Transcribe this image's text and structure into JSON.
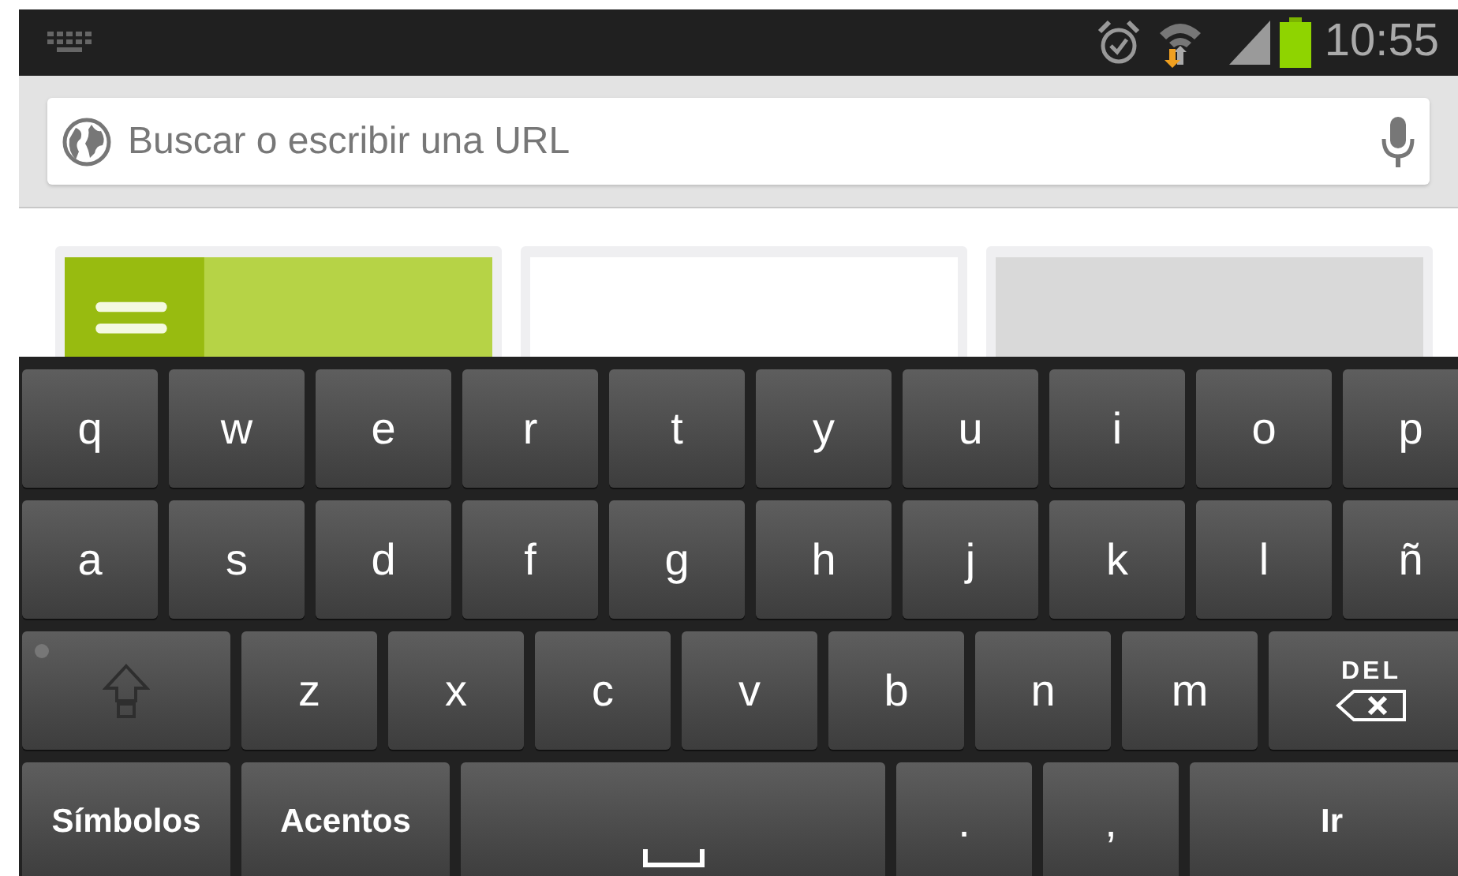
{
  "status_bar": {
    "time": "10:55"
  },
  "address_bar": {
    "placeholder": "Buscar o escribir una URL"
  },
  "thumbnails": [
    {
      "kind": "picture"
    },
    {
      "kind": "blank"
    },
    {
      "kind": "loading"
    }
  ],
  "keyboard": {
    "rows": [
      [
        {
          "kind": "char",
          "label": "q"
        },
        {
          "kind": "char",
          "label": "w"
        },
        {
          "kind": "char",
          "label": "e"
        },
        {
          "kind": "char",
          "label": "r"
        },
        {
          "kind": "char",
          "label": "t"
        },
        {
          "kind": "char",
          "label": "y"
        },
        {
          "kind": "char",
          "label": "u"
        },
        {
          "kind": "char",
          "label": "i"
        },
        {
          "kind": "char",
          "label": "o"
        },
        {
          "kind": "char",
          "label": "p"
        }
      ],
      [
        {
          "kind": "char",
          "label": "a"
        },
        {
          "kind": "char",
          "label": "s"
        },
        {
          "kind": "char",
          "label": "d"
        },
        {
          "kind": "char",
          "label": "f"
        },
        {
          "kind": "char",
          "label": "g"
        },
        {
          "kind": "char",
          "label": "h"
        },
        {
          "kind": "char",
          "label": "j"
        },
        {
          "kind": "char",
          "label": "k"
        },
        {
          "kind": "char",
          "label": "l"
        },
        {
          "kind": "char",
          "label": "ñ"
        }
      ],
      [
        {
          "kind": "shift"
        },
        {
          "kind": "char",
          "label": "z"
        },
        {
          "kind": "char",
          "label": "x"
        },
        {
          "kind": "char",
          "label": "c"
        },
        {
          "kind": "char",
          "label": "v"
        },
        {
          "kind": "char",
          "label": "b"
        },
        {
          "kind": "char",
          "label": "n"
        },
        {
          "kind": "char",
          "label": "m"
        },
        {
          "kind": "delete",
          "label": "DEL"
        }
      ],
      [
        {
          "kind": "mode",
          "label": "Símbolos"
        },
        {
          "kind": "mode",
          "label": "Acentos"
        },
        {
          "kind": "space"
        },
        {
          "kind": "char",
          "label": "."
        },
        {
          "kind": "char",
          "label": ","
        },
        {
          "kind": "action",
          "label": "Ir"
        }
      ]
    ]
  }
}
